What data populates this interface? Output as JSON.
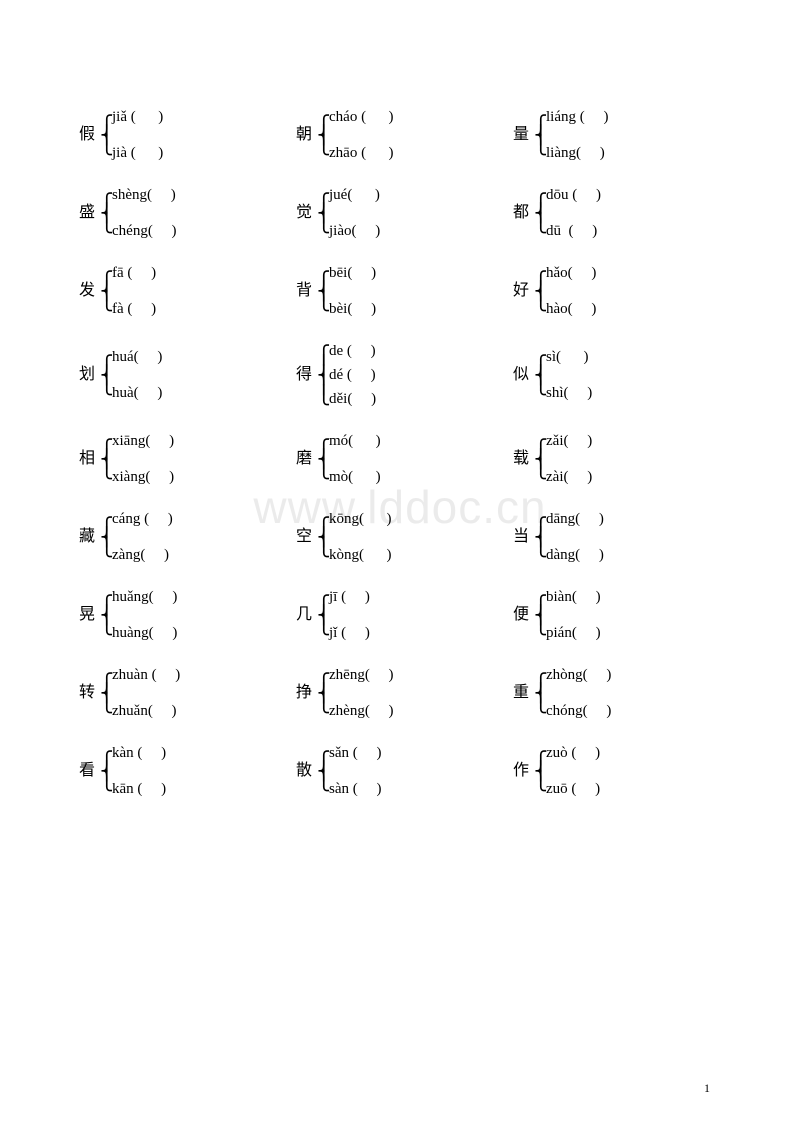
{
  "page_number": "1",
  "watermark": "www.lddoc.cn",
  "rows": [
    [
      {
        "hanzi": "假",
        "pinyins": [
          "jiǎ (      )",
          "jià (      )"
        ]
      },
      {
        "hanzi": "朝",
        "pinyins": [
          "cháo (      )",
          "zhāo (      )"
        ]
      },
      {
        "hanzi": "量",
        "pinyins": [
          "liáng (     )",
          "liàng(     )"
        ]
      }
    ],
    [
      {
        "hanzi": "盛",
        "pinyins": [
          "shèng(     )",
          "chéng(     )"
        ]
      },
      {
        "hanzi": "觉",
        "pinyins": [
          "jué(      )",
          "jiào(     )"
        ]
      },
      {
        "hanzi": "都",
        "pinyins": [
          "dōu (     )",
          "dū  (     )"
        ]
      }
    ],
    [
      {
        "hanzi": "发",
        "pinyins": [
          "fā (     )",
          "fà (     )"
        ]
      },
      {
        "hanzi": "背",
        "pinyins": [
          "bēi(     )",
          "bèi(     )"
        ]
      },
      {
        "hanzi": "好",
        "pinyins": [
          "hǎo(     )",
          "hào(     )"
        ]
      }
    ],
    [
      {
        "hanzi": "划",
        "pinyins": [
          "huá(     )",
          "huà(     )"
        ]
      },
      {
        "hanzi": "得",
        "pinyins": [
          "de (     )",
          "dé (     )",
          "děi(     )"
        ]
      },
      {
        "hanzi": "似",
        "pinyins": [
          "sì(      )",
          "shì(     )"
        ]
      }
    ],
    [
      {
        "hanzi": "相",
        "pinyins": [
          "xiāng(     )",
          "xiàng(     )"
        ]
      },
      {
        "hanzi": "磨",
        "pinyins": [
          "mó(      )",
          "mò(      )"
        ]
      },
      {
        "hanzi": "载",
        "pinyins": [
          "zǎi(     )",
          "zài(     )"
        ]
      }
    ],
    [
      {
        "hanzi": "藏",
        "pinyins": [
          "cáng (     )",
          "zàng(     )"
        ]
      },
      {
        "hanzi": "空",
        "pinyins": [
          "kōng(      )",
          "kòng(      )"
        ]
      },
      {
        "hanzi": "当",
        "pinyins": [
          "dāng(     )",
          "dàng(     )"
        ]
      }
    ],
    [
      {
        "hanzi": "晃",
        "pinyins": [
          "huǎng(     )",
          "huàng(     )"
        ]
      },
      {
        "hanzi": "几",
        "pinyins": [
          "jī (     )",
          "jǐ (     )"
        ]
      },
      {
        "hanzi": "便",
        "pinyins": [
          "biàn(     )",
          "pián(     )"
        ]
      }
    ],
    [
      {
        "hanzi": "转",
        "pinyins": [
          "zhuàn (     )",
          "zhuǎn(     )"
        ]
      },
      {
        "hanzi": "挣",
        "pinyins": [
          "zhēng(     )",
          "zhèng(     )"
        ]
      },
      {
        "hanzi": "重",
        "pinyins": [
          "zhòng(     )",
          "chóng(     )"
        ]
      }
    ],
    [
      {
        "hanzi": "看",
        "pinyins": [
          "kàn (     )",
          "kān (     )"
        ]
      },
      {
        "hanzi": "散",
        "pinyins": [
          "sǎn (     )",
          "sàn (     )"
        ]
      },
      {
        "hanzi": "作",
        "pinyins": [
          "zuò (     )",
          "zuō (     )"
        ]
      }
    ]
  ]
}
